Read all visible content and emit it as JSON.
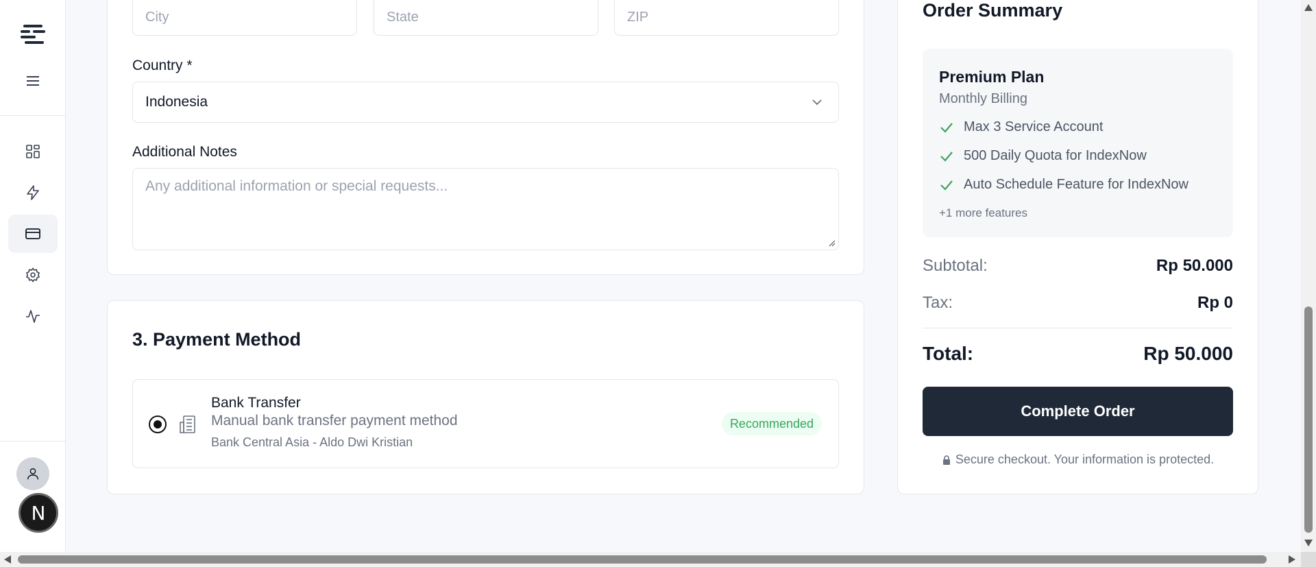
{
  "address": {
    "city_placeholder": "City",
    "state_placeholder": "State",
    "zip_placeholder": "ZIP"
  },
  "country": {
    "label": "Country *",
    "value": "Indonesia"
  },
  "notes": {
    "label": "Additional Notes",
    "placeholder": "Any additional information or special requests..."
  },
  "payment": {
    "section_title": "3. Payment Method",
    "method_title": "Bank Transfer",
    "method_desc": "Manual bank transfer payment method",
    "bank_info": "Bank Central Asia - Aldo Dwi Kristian",
    "badge": "Recommended"
  },
  "summary": {
    "title": "Order Summary",
    "plan_name": "Premium Plan",
    "billing": "Monthly Billing",
    "features": [
      "Max 3 Service Account",
      "500 Daily Quota for IndexNow",
      "Auto Schedule Feature for IndexNow"
    ],
    "more_features": "+1 more features",
    "subtotal_label": "Subtotal:",
    "subtotal_value": "Rp 50.000",
    "tax_label": "Tax:",
    "tax_value": "Rp 0",
    "total_label": "Total:",
    "total_value": "Rp 50.000",
    "button": "Complete Order",
    "secure_note": "Secure checkout. Your information is protected."
  },
  "sidebar": {
    "avatar_letter": "N"
  },
  "colors": {
    "accent_dark": "#1f2937",
    "success": "#3aa55b",
    "badge_bg": "#ecfdf3"
  }
}
